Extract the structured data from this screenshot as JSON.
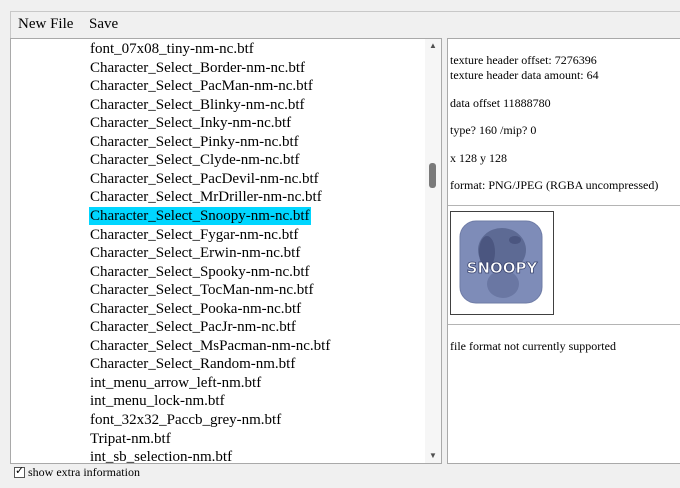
{
  "menu": {
    "new_file_label": "New File",
    "save_label": "Save"
  },
  "file_list": {
    "items": [
      "font_07x08_tiny-nm-nc.btf",
      "Character_Select_Border-nm-nc.btf",
      "Character_Select_PacMan-nm-nc.btf",
      "Character_Select_Blinky-nm-nc.btf",
      "Character_Select_Inky-nm-nc.btf",
      "Character_Select_Pinky-nm-nc.btf",
      "Character_Select_Clyde-nm-nc.btf",
      "Character_Select_PacDevil-nm-nc.btf",
      "Character_Select_MrDriller-nm-nc.btf",
      "Character_Select_Snoopy-nm-nc.btf",
      "Character_Select_Fygar-nm-nc.btf",
      "Character_Select_Erwin-nm-nc.btf",
      "Character_Select_Spooky-nm-nc.btf",
      "Character_Select_TocMan-nm-nc.btf",
      "Character_Select_Pooka-nm-nc.btf",
      "Character_Select_PacJr-nm-nc.btf",
      "Character_Select_MsPacman-nm-nc.btf",
      "Character_Select_Random-nm.btf",
      "int_menu_arrow_left-nm.btf",
      "int_menu_lock-nm.btf",
      "font_32x32_Paccb_grey-nm.btf",
      "Tripat-nm.btf",
      "int_sb_selection-nm.btf"
    ],
    "selected_index": 9,
    "scroll_up_glyph": "▲",
    "scroll_down_glyph": "▼"
  },
  "info": {
    "texture_header_offset": "texture header offset: 7276396",
    "texture_header_data_amount": "texture header data amount: 64",
    "data_offset": "data offset 11888780",
    "type_mip": "type? 160 /mip? 0",
    "dimensions": "x 128 y 128",
    "format": "format: PNG/JPEG (RGBA uncompressed)",
    "preview_logo_text": "SNOOPY",
    "status_message": "file format not currently supported"
  },
  "footer": {
    "checkbox_checked": true,
    "checkbox_label": "show extra information"
  },
  "colors": {
    "selection": "#00d6ff",
    "preview_bg": "#7e8cb8"
  }
}
